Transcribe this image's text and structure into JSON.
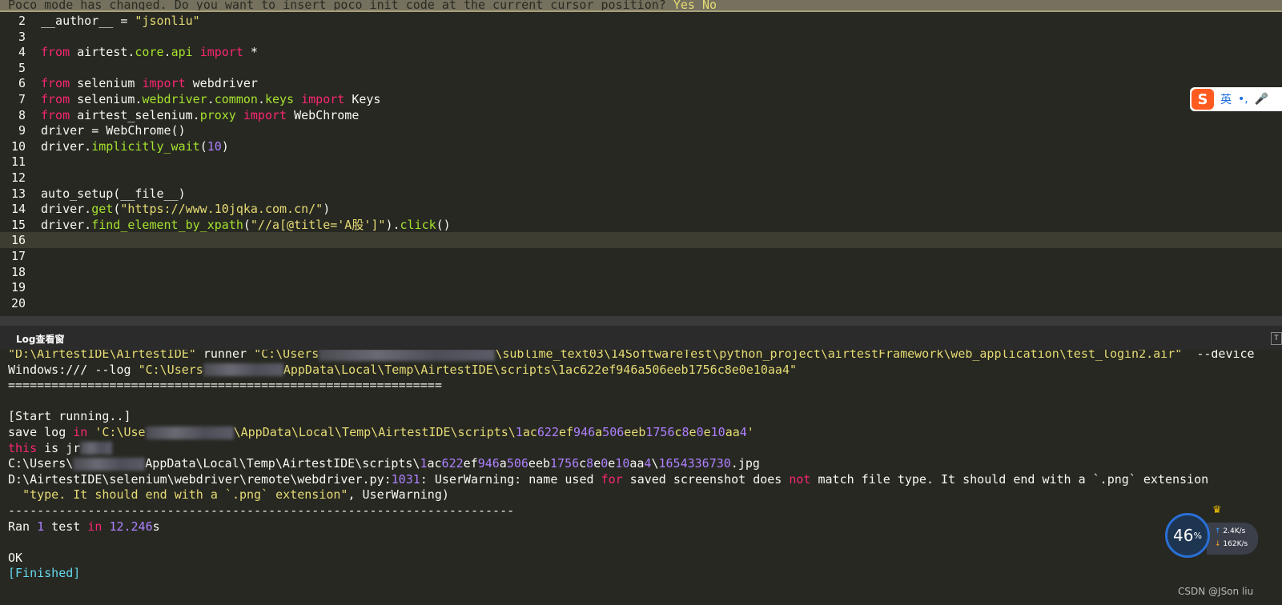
{
  "notice": {
    "text": "Poco mode has changed. Do you want to insert poco init code at the current cursor position?",
    "yes": "Yes",
    "no": "No"
  },
  "editor": {
    "lines": [
      {
        "n": "2",
        "parts": [
          [
            "",
            "__author__ = "
          ],
          [
            "str",
            "\"jsonliu\""
          ]
        ]
      },
      {
        "n": "3",
        "parts": []
      },
      {
        "n": "4",
        "parts": [
          [
            "kw",
            "from"
          ],
          [
            "",
            " airtest."
          ],
          [
            "fn",
            "core"
          ],
          [
            "",
            "."
          ],
          [
            "fn",
            "api"
          ],
          [
            "",
            " "
          ],
          [
            "kw",
            "import"
          ],
          [
            "",
            " *"
          ]
        ]
      },
      {
        "n": "5",
        "parts": []
      },
      {
        "n": "6",
        "parts": [
          [
            "kw",
            "from"
          ],
          [
            "",
            " selenium "
          ],
          [
            "kw",
            "import"
          ],
          [
            "",
            " webdriver"
          ]
        ]
      },
      {
        "n": "7",
        "parts": [
          [
            "kw",
            "from"
          ],
          [
            "",
            " selenium."
          ],
          [
            "fn",
            "webdriver"
          ],
          [
            "",
            "."
          ],
          [
            "fn",
            "common"
          ],
          [
            "",
            "."
          ],
          [
            "fn",
            "keys"
          ],
          [
            "",
            " "
          ],
          [
            "kw",
            "import"
          ],
          [
            "",
            " Keys"
          ]
        ]
      },
      {
        "n": "8",
        "parts": [
          [
            "kw",
            "from"
          ],
          [
            "",
            " airtest_selenium."
          ],
          [
            "fn",
            "proxy"
          ],
          [
            "",
            " "
          ],
          [
            "kw",
            "import"
          ],
          [
            "",
            " WebChrome"
          ]
        ]
      },
      {
        "n": "9",
        "parts": [
          [
            "",
            "driver = WebChrome()"
          ]
        ]
      },
      {
        "n": "10",
        "parts": [
          [
            "",
            "driver."
          ],
          [
            "fn",
            "implicitly_wait"
          ],
          [
            "",
            "("
          ],
          [
            "num",
            "10"
          ],
          [
            "",
            ")"
          ]
        ]
      },
      {
        "n": "11",
        "parts": []
      },
      {
        "n": "12",
        "parts": []
      },
      {
        "n": "13",
        "parts": [
          [
            "",
            "auto_setup(__file__)"
          ]
        ]
      },
      {
        "n": "14",
        "parts": [
          [
            "",
            "driver."
          ],
          [
            "fn",
            "get"
          ],
          [
            "",
            "("
          ],
          [
            "str",
            "\"https://www.10jqka.com.cn/\""
          ],
          [
            "",
            ")"
          ]
        ]
      },
      {
        "n": "15",
        "parts": [
          [
            "",
            "driver."
          ],
          [
            "fn",
            "find_element_by_xpath"
          ],
          [
            "",
            "("
          ],
          [
            "str",
            "\"//a[@title='A股']\""
          ],
          [
            "",
            ")."
          ],
          [
            "fn",
            "click"
          ],
          [
            "",
            "()"
          ]
        ]
      },
      {
        "n": "16",
        "parts": [],
        "current": true
      },
      {
        "n": "17",
        "parts": []
      },
      {
        "n": "18",
        "parts": []
      },
      {
        "n": "19",
        "parts": []
      },
      {
        "n": "20",
        "parts": []
      }
    ]
  },
  "ime": {
    "logo": "S",
    "lang": "英",
    "punct": "•,",
    "mic": "🎤"
  },
  "log_panel": {
    "title": "Log查看窗",
    "toggle_label": "T"
  },
  "log": {
    "lines": [
      {
        "parts": [
          [
            "str",
            "\"D:\\AirtestIDE\\AirtestIDE\""
          ],
          [
            "",
            " runner "
          ],
          [
            "str",
            "\"C:\\Users"
          ],
          [
            "blur",
            "220"
          ],
          [
            "str",
            "\\sublime_text03\\14SoftwareTest\\python_project\\airtestFramework\\web_application\\test_login2.air\""
          ],
          [
            "",
            "  --device"
          ]
        ]
      },
      {
        "parts": [
          [
            "",
            "Windows:/// --log "
          ],
          [
            "str",
            "\"C:\\Users"
          ],
          [
            "blur",
            "100"
          ],
          [
            "str",
            "AppData\\Local\\Temp\\AirtestIDE\\scripts\\1ac622ef946a506eeb1756c8e0e10aa4\""
          ]
        ]
      },
      {
        "parts": [
          [
            "",
            "============================================================"
          ]
        ]
      },
      {
        "parts": []
      },
      {
        "parts": [
          [
            "",
            "[Start running..]"
          ]
        ]
      },
      {
        "parts": [
          [
            "",
            "save log "
          ],
          [
            "kw",
            "in"
          ],
          [
            "",
            " "
          ],
          [
            "str",
            "'C:\\Use"
          ],
          [
            "blur",
            "110"
          ],
          [
            "str",
            "\\AppData\\Local\\Temp\\AirtestIDE\\scripts\\"
          ],
          [
            "num",
            "1"
          ],
          [
            "str",
            "ac"
          ],
          [
            "num",
            "622"
          ],
          [
            "str",
            "ef"
          ],
          [
            "num",
            "946"
          ],
          [
            "str",
            "a"
          ],
          [
            "num",
            "506"
          ],
          [
            "str",
            "eeb"
          ],
          [
            "num",
            "1756"
          ],
          [
            "str",
            "c"
          ],
          [
            "num",
            "8"
          ],
          [
            "str",
            "e"
          ],
          [
            "num",
            "0"
          ],
          [
            "str",
            "e"
          ],
          [
            "num",
            "10"
          ],
          [
            "str",
            "aa"
          ],
          [
            "num",
            "4"
          ],
          [
            "str",
            "'"
          ]
        ]
      },
      {
        "parts": [
          [
            "kw",
            "this"
          ],
          [
            "",
            " is jr"
          ],
          [
            "blur",
            "40"
          ]
        ]
      },
      {
        "parts": [
          [
            "",
            "C:\\Users\\"
          ],
          [
            "blur",
            "90"
          ],
          [
            "",
            "AppData\\Local\\Temp\\AirtestIDE\\scripts\\"
          ],
          [
            "num",
            "1"
          ],
          [
            "",
            "ac"
          ],
          [
            "num",
            "622"
          ],
          [
            "",
            "ef"
          ],
          [
            "num",
            "946"
          ],
          [
            "",
            "a"
          ],
          [
            "num",
            "506"
          ],
          [
            "",
            "eeb"
          ],
          [
            "num",
            "1756"
          ],
          [
            "",
            "c"
          ],
          [
            "num",
            "8"
          ],
          [
            "",
            "e"
          ],
          [
            "num",
            "0"
          ],
          [
            "",
            "e"
          ],
          [
            "num",
            "10"
          ],
          [
            "",
            "aa"
          ],
          [
            "num",
            "4"
          ],
          [
            "",
            "\\"
          ],
          [
            "num",
            "1654336730"
          ],
          [
            "",
            ".jpg"
          ]
        ]
      },
      {
        "parts": [
          [
            "",
            "D:\\AirtestIDE\\selenium\\webdriver\\remote\\webdriver.py:"
          ],
          [
            "num",
            "1031"
          ],
          [
            "",
            ": UserWarning: name used "
          ],
          [
            "kw",
            "for"
          ],
          [
            "",
            " saved screenshot does "
          ],
          [
            "kw",
            "not"
          ],
          [
            "",
            " match file type. It should end with a `.png` extension"
          ]
        ]
      },
      {
        "parts": [
          [
            "",
            "  "
          ],
          [
            "str",
            "\"type. It should end with a `.png` extension\""
          ],
          [
            "",
            ", UserWarning)"
          ]
        ]
      },
      {
        "parts": [
          [
            "",
            "----------------------------------------------------------------------"
          ]
        ]
      },
      {
        "parts": [
          [
            "",
            "Ran "
          ],
          [
            "num",
            "1"
          ],
          [
            "",
            " test "
          ],
          [
            "kw",
            "in"
          ],
          [
            "",
            " "
          ],
          [
            "num",
            "12.246"
          ],
          [
            "",
            "s"
          ]
        ]
      },
      {
        "parts": []
      },
      {
        "parts": [
          [
            "",
            "OK"
          ]
        ]
      },
      {
        "parts": [
          [
            "link",
            "[Finished]"
          ]
        ]
      }
    ]
  },
  "net_widget": {
    "percent": "46",
    "percent_unit": "%",
    "up": "2.4K/s",
    "down": "162K/s",
    "up_arrow": "↑",
    "down_arrow": "↓",
    "crown": "♛"
  },
  "watermark": "CSDN @JSon  liu"
}
